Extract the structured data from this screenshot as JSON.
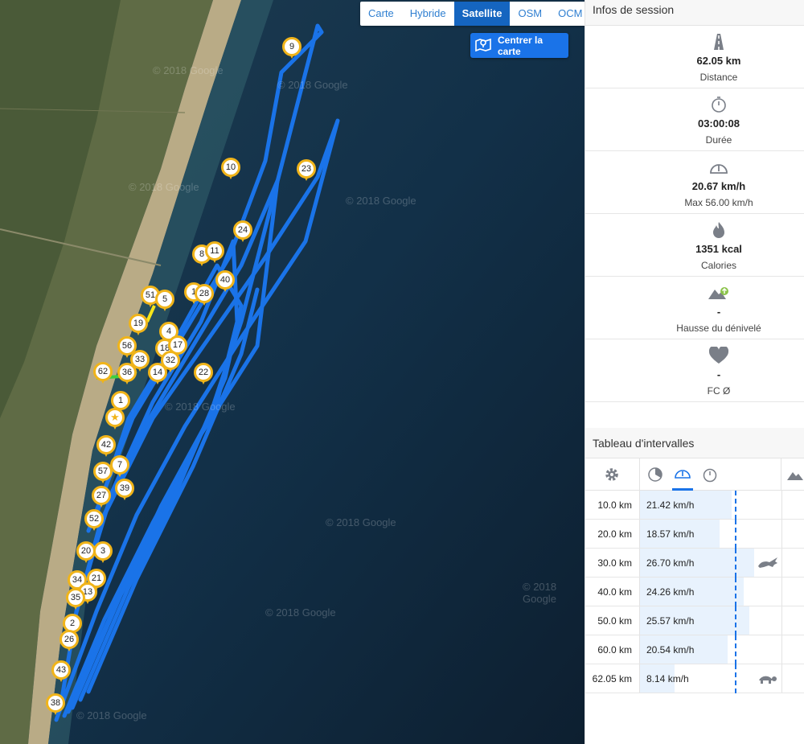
{
  "map": {
    "map_types": [
      {
        "label": "Carte",
        "active": false
      },
      {
        "label": "Hybride",
        "active": false
      },
      {
        "label": "Satellite",
        "active": true
      },
      {
        "label": "OSM",
        "active": false
      },
      {
        "label": "OCM",
        "active": false
      }
    ],
    "center_button_label": "Centrer la carte",
    "watermark_text": "© 2018 Google",
    "markers": [
      "9",
      "10",
      "23",
      "24",
      "8",
      "11",
      "40",
      "51",
      "5",
      "1",
      "28",
      "19",
      "4",
      "56",
      "18",
      "17",
      "33",
      "32",
      "62",
      "36",
      "14",
      "22",
      "1",
      "★",
      "42",
      "7",
      "57",
      "39",
      "27",
      "52",
      "20",
      "3",
      "21",
      "34",
      "13",
      "35",
      "2",
      "26",
      "43",
      "38"
    ]
  },
  "session": {
    "title": "Infos de session",
    "stats": [
      {
        "icon": "road-icon",
        "value": "62.05 km",
        "label": "Distance"
      },
      {
        "icon": "stopwatch-icon",
        "value": "03:00:08",
        "label": "Durée"
      },
      {
        "icon": "speedometer-icon",
        "value": "20.67 km/h",
        "label": "Max 56.00 km/h"
      },
      {
        "icon": "flame-icon",
        "value": "1351 kcal",
        "label": "Calories"
      },
      {
        "icon": "elevation-icon",
        "value": "-",
        "label": "Hausse du dénivelé"
      },
      {
        "icon": "heart-icon",
        "value": "-",
        "label": "FC Ø"
      }
    ]
  },
  "intervals": {
    "title": "Tableau d'intervalles",
    "rows": [
      {
        "distance": "10.0 km",
        "speed": "21.42 km/h",
        "speed_value": 21.42,
        "badge": ""
      },
      {
        "distance": "20.0 km",
        "speed": "18.57 km/h",
        "speed_value": 18.57,
        "badge": ""
      },
      {
        "distance": "30.0 km",
        "speed": "26.70 km/h",
        "speed_value": 26.7,
        "badge": "rabbit-icon"
      },
      {
        "distance": "40.0 km",
        "speed": "24.26 km/h",
        "speed_value": 24.26,
        "badge": ""
      },
      {
        "distance": "50.0 km",
        "speed": "25.57 km/h",
        "speed_value": 25.57,
        "badge": ""
      },
      {
        "distance": "60.0 km",
        "speed": "20.54 km/h",
        "speed_value": 20.54,
        "badge": ""
      },
      {
        "distance": "62.05 km",
        "speed": "8.14 km/h",
        "speed_value": 8.14,
        "badge": "turtle-icon"
      }
    ],
    "average_speed": 20.67
  }
}
